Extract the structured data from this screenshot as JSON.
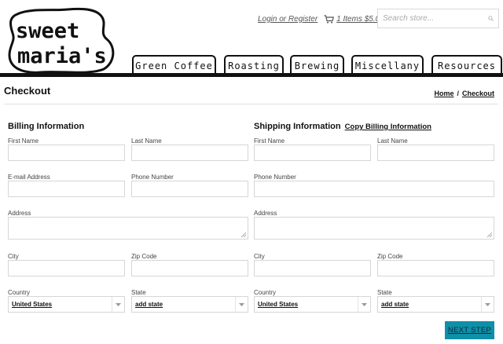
{
  "logo": {
    "line1": "sweet",
    "line2": "maria's"
  },
  "top": {
    "login_label": "Login or Register",
    "cart_label": "1 Items $5.00",
    "search_placeholder": "Search store..."
  },
  "nav": {
    "tabs": [
      {
        "label": "Green Coffee"
      },
      {
        "label": "Roasting"
      },
      {
        "label": "Brewing"
      },
      {
        "label": "Miscellany"
      },
      {
        "label": "Resources"
      }
    ]
  },
  "page": {
    "title": "Checkout",
    "breadcrumb": {
      "home": "Home",
      "separator": "/",
      "current": "Checkout"
    }
  },
  "billing": {
    "title": "Billing Information",
    "first_name_label": "First Name",
    "last_name_label": "Last Name",
    "email_label": "E-mail Address",
    "phone_label": "Phone Number",
    "address_label": "Address",
    "city_label": "City",
    "zip_label": "Zip Code",
    "country_label": "Country",
    "country_value": "United States",
    "state_label": "State",
    "state_value": "add state"
  },
  "shipping": {
    "title": "Shipping Information",
    "copy_link": "Copy Billing Information",
    "first_name_label": "First Name",
    "last_name_label": "Last Name",
    "phone_label": "Phone Number",
    "address_label": "Address",
    "city_label": "City",
    "zip_label": "Zip Code",
    "country_label": "Country",
    "country_value": "United States",
    "state_label": "State",
    "state_value": "add state"
  },
  "next_button": "NEXT STEP",
  "colors": {
    "accent": "#0f8fa8",
    "ink": "#111111"
  }
}
